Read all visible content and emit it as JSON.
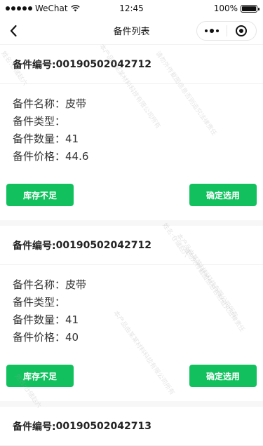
{
  "status_bar": {
    "carrier": "WeChat",
    "time": "12:45",
    "battery": "100%"
  },
  "nav": {
    "title": "备件列表",
    "back_icon": "chevron-left-icon",
    "more_icon": "more-dots-icon",
    "close_icon": "target-circle-icon"
  },
  "colors": {
    "accent": "#12c15e"
  },
  "cards": [
    {
      "code_label": "备件编号:",
      "code": "00190502042712",
      "name_label": "备件名称：",
      "name": "皮带",
      "type_label": "备件类型：",
      "type": "",
      "qty_label": "备件数量：",
      "qty": "41",
      "price_label": "备件价格：",
      "price": "44.6",
      "btn_left": "库存不足",
      "btn_right": "确定选用"
    },
    {
      "code_label": "备件编号:",
      "code": "00190502042712",
      "name_label": "备件名称：",
      "name": "皮带",
      "type_label": "备件类型：",
      "type": "",
      "qty_label": "备件数量：",
      "qty": "41",
      "price_label": "备件价格：",
      "price": "40",
      "btn_left": "库存不足",
      "btn_right": "确定选用"
    },
    {
      "code_label": "备件编号:",
      "code": "00190502042713"
    }
  ],
  "watermark": {
    "line1": "姓名:仓储赵六",
    "line2": "本产品由某某材料科技有限公司所有",
    "line3": "请勿外传截图信息否则追究法律责任"
  }
}
